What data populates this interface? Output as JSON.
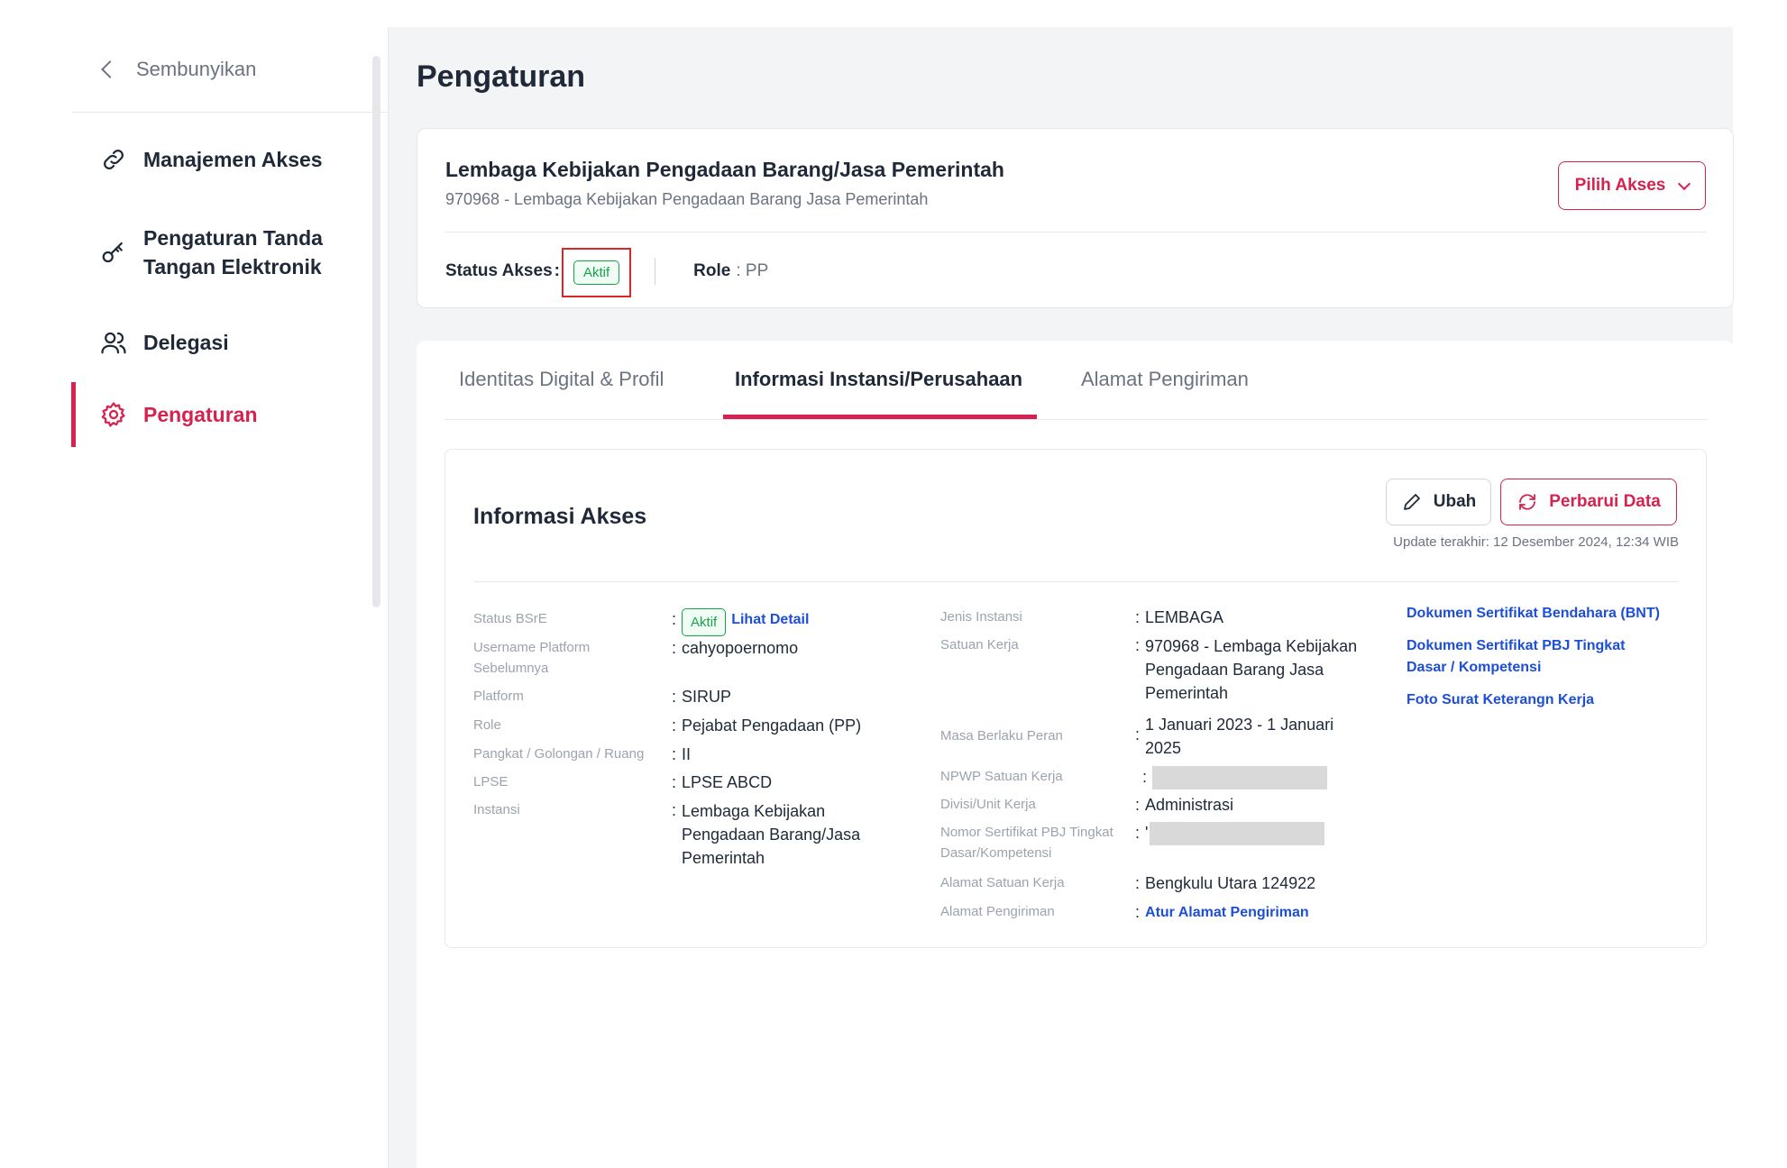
{
  "sidebar": {
    "hide_label": "Sembunyikan",
    "items": [
      {
        "label": "Manajemen Akses",
        "icon": "link-icon"
      },
      {
        "label_line1": "Pengaturan Tanda",
        "label_line2": "Tangan Elektronik",
        "icon": "key-icon"
      },
      {
        "label": "Delegasi",
        "icon": "users-icon"
      },
      {
        "label": "Pengaturan",
        "icon": "gear-icon",
        "active": true
      }
    ]
  },
  "page": {
    "title": "Pengaturan"
  },
  "org": {
    "name": "Lembaga Kebijakan Pengadaan Barang/Jasa Pemerintah",
    "sub": "970968 - Lembaga Kebijakan Pengadaan Barang Jasa Pemerintah",
    "pilih_akses": "Pilih Akses",
    "status_label": "Status Akses",
    "colon": ":",
    "status_value": "Aktif",
    "role_label": "Role",
    "role_value": ": PP"
  },
  "tabs": [
    {
      "label": "Identitas Digital & Profil"
    },
    {
      "label": "Informasi Instansi/Perusahaan",
      "active": true
    },
    {
      "label": "Alamat Pengiriman"
    }
  ],
  "info": {
    "title": "Informasi Akses",
    "ubah": "Ubah",
    "perbarui": "Perbarui Data",
    "update": "Update terakhir: 12 Desember 2024, 12:34 WIB",
    "left": {
      "status_bsre": {
        "label": "Status BSrE",
        "value": "Aktif",
        "link": "Lihat Detail"
      },
      "username_l1": "Username Platform",
      "username_l2": "Sebelumnya",
      "username_val": "cahyopoernomo",
      "platform": {
        "label": "Platform",
        "value": "SIRUP"
      },
      "role": {
        "label": "Role",
        "value": "Pejabat Pengadaan (PP)"
      },
      "pangkat": {
        "label": "Pangkat / Golongan / Ruang",
        "value": "II"
      },
      "lpse": {
        "label": "LPSE",
        "value": "LPSE ABCD"
      },
      "instansi": {
        "label": "Instansi",
        "v1": "Lembaga Kebijakan",
        "v2": "Pengadaan Barang/Jasa",
        "v3": "Pemerintah"
      }
    },
    "right": {
      "jenis": {
        "label": "Jenis Instansi",
        "value": "LEMBAGA"
      },
      "satuan": {
        "label": "Satuan Kerja",
        "v1": "970968 - Lembaga Kebijakan",
        "v2": "Pengadaan Barang Jasa",
        "v3": "Pemerintah"
      },
      "masa": {
        "label": "Masa Berlaku Peran",
        "v1": "1 Januari 2023 - 1 Januari",
        "v2": "2025"
      },
      "npwp": {
        "label": "NPWP Satuan Kerja"
      },
      "divisi": {
        "label": "Divisi/Unit Kerja",
        "value": "Administrasi"
      },
      "nomor": {
        "label_l1": "Nomor Sertifikat PBJ Tingkat",
        "label_l2": "Dasar/Kompetensi",
        "prefix": "'"
      },
      "alamat_sk": {
        "label": "Alamat Satuan Kerja",
        "value": "Bengkulu Utara 124922"
      },
      "alamat_p": {
        "label": "Alamat Pengiriman",
        "link": "Atur Alamat Pengiriman"
      }
    },
    "docs": {
      "d1": "Dokumen Sertifikat Bendahara (BNT)",
      "d2_l1": "Dokumen Sertifikat PBJ Tingkat",
      "d2_l2": "Dasar / Kompetensi",
      "d3": "Foto Surat Keterangn Kerja"
    }
  },
  "colors": {
    "accent": "#d6224f",
    "success": "#16a34a",
    "link": "#1d4ed8"
  }
}
